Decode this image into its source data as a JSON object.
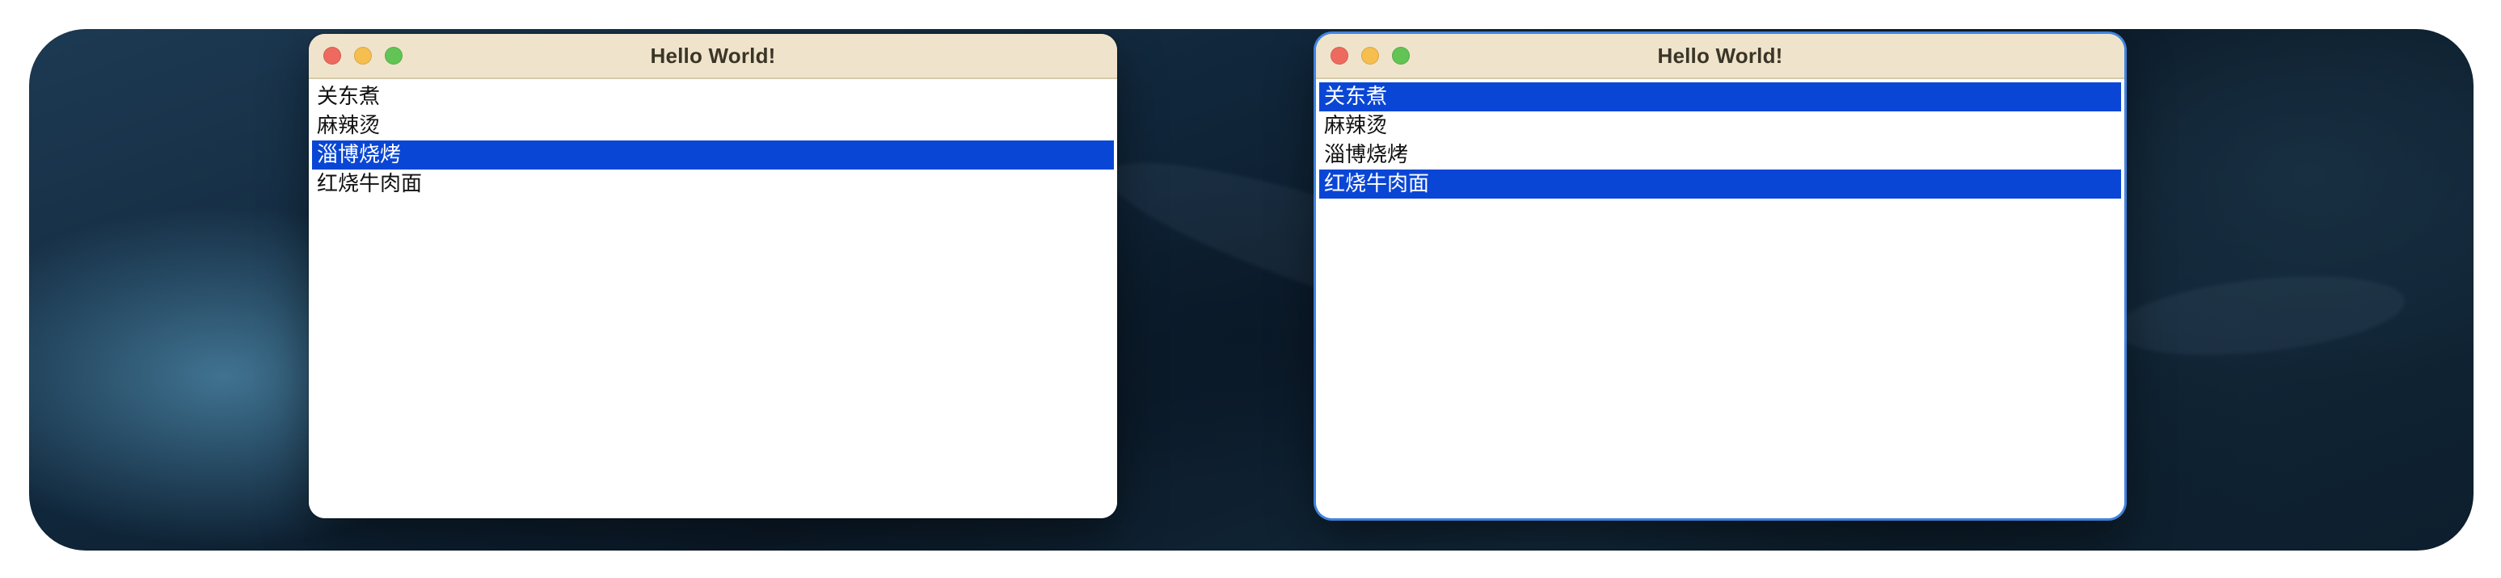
{
  "windows": [
    {
      "title": "Hello World!",
      "focused": false,
      "items": [
        {
          "label": "关东煮",
          "selected": false
        },
        {
          "label": "麻辣烫",
          "selected": false
        },
        {
          "label": "淄博烧烤",
          "selected": true
        },
        {
          "label": "红烧牛肉面",
          "selected": false
        }
      ]
    },
    {
      "title": "Hello World!",
      "focused": true,
      "items": [
        {
          "label": "关东煮",
          "selected": true
        },
        {
          "label": "麻辣烫",
          "selected": false
        },
        {
          "label": "淄博烧烤",
          "selected": false
        },
        {
          "label": "红烧牛肉面",
          "selected": true
        }
      ]
    }
  ],
  "icons": {
    "close": "close-button",
    "minimize": "minimize-button",
    "maximize": "maximize-button"
  },
  "colors": {
    "selection": "#0a46d6",
    "titlebar": "#efe4cb",
    "close": "#ee6a5f",
    "minimize": "#f5be4f",
    "maximize": "#61c454"
  }
}
